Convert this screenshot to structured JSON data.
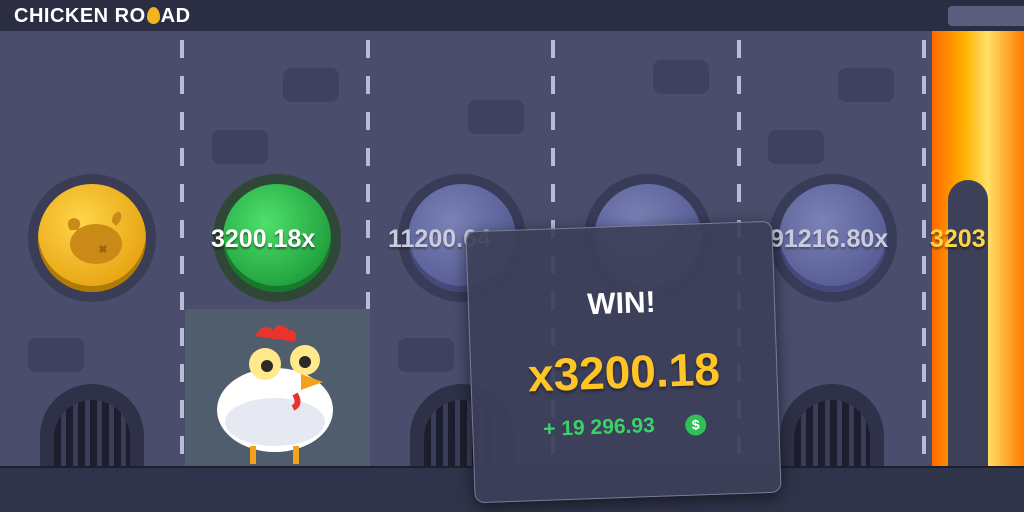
{
  "header": {
    "logo_part1": "CHICKEN RO",
    "logo_part2": "AD"
  },
  "lanes": [
    {
      "multiplier": "",
      "state": "collected"
    },
    {
      "multiplier": "3200.18x",
      "state": "current"
    },
    {
      "multiplier": "11200.64",
      "state": "upcoming"
    },
    {
      "multiplier": "",
      "state": "upcoming"
    },
    {
      "multiplier": "91216.80x",
      "state": "upcoming"
    },
    {
      "multiplier": "3203",
      "state": "upcoming"
    }
  ],
  "win_dialog": {
    "title": "WIN!",
    "multiplier": "x3200.18",
    "amount": "+ 19 296.93",
    "currency_icon": "$"
  },
  "colors": {
    "gold": "#f2b51d",
    "green": "#1f9d3b",
    "win_text": "#ffc425",
    "amount": "#3bd267"
  }
}
